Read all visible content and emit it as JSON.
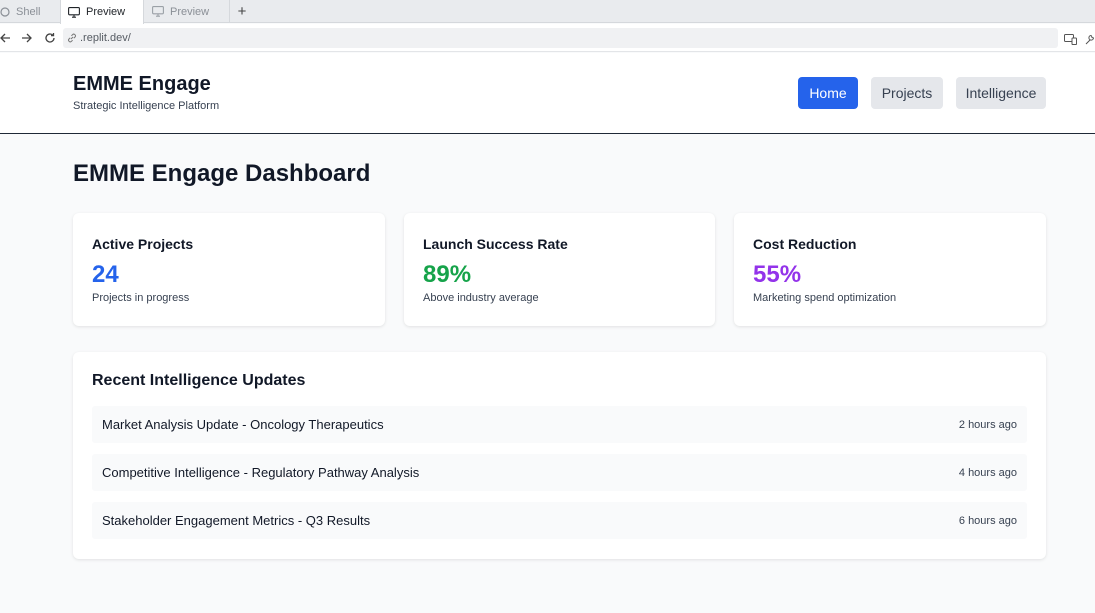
{
  "browser": {
    "tabs": [
      {
        "label": "Shell"
      },
      {
        "label": "Preview"
      },
      {
        "label": "Preview"
      }
    ],
    "new_tab_label": "+",
    "url": ".replit.dev/"
  },
  "header": {
    "title": "EMME Engage",
    "subtitle": "Strategic Intelligence Platform",
    "nav": [
      {
        "label": "Home"
      },
      {
        "label": "Projects"
      },
      {
        "label": "Intelligence"
      }
    ]
  },
  "main": {
    "title": "EMME Engage Dashboard",
    "stats": [
      {
        "label": "Active Projects",
        "value": "24",
        "desc": "Projects in progress",
        "color": "#2563eb"
      },
      {
        "label": "Launch Success Rate",
        "value": "89%",
        "desc": "Above industry average",
        "color": "#16a34a"
      },
      {
        "label": "Cost Reduction",
        "value": "55%",
        "desc": "Marketing spend optimization",
        "color": "#9333ea"
      }
    ],
    "updates": {
      "title": "Recent Intelligence Updates",
      "items": [
        {
          "text": "Market Analysis Update - Oncology Therapeutics",
          "time": "2 hours ago"
        },
        {
          "text": "Competitive Intelligence - Regulatory Pathway Analysis",
          "time": "4 hours ago"
        },
        {
          "text": "Stakeholder Engagement Metrics - Q3 Results",
          "time": "6 hours ago"
        }
      ]
    }
  },
  "colors": {
    "primary": "#2563eb",
    "nav_inactive_bg": "#e5e7eb",
    "page_bg": "#f9fafb"
  }
}
